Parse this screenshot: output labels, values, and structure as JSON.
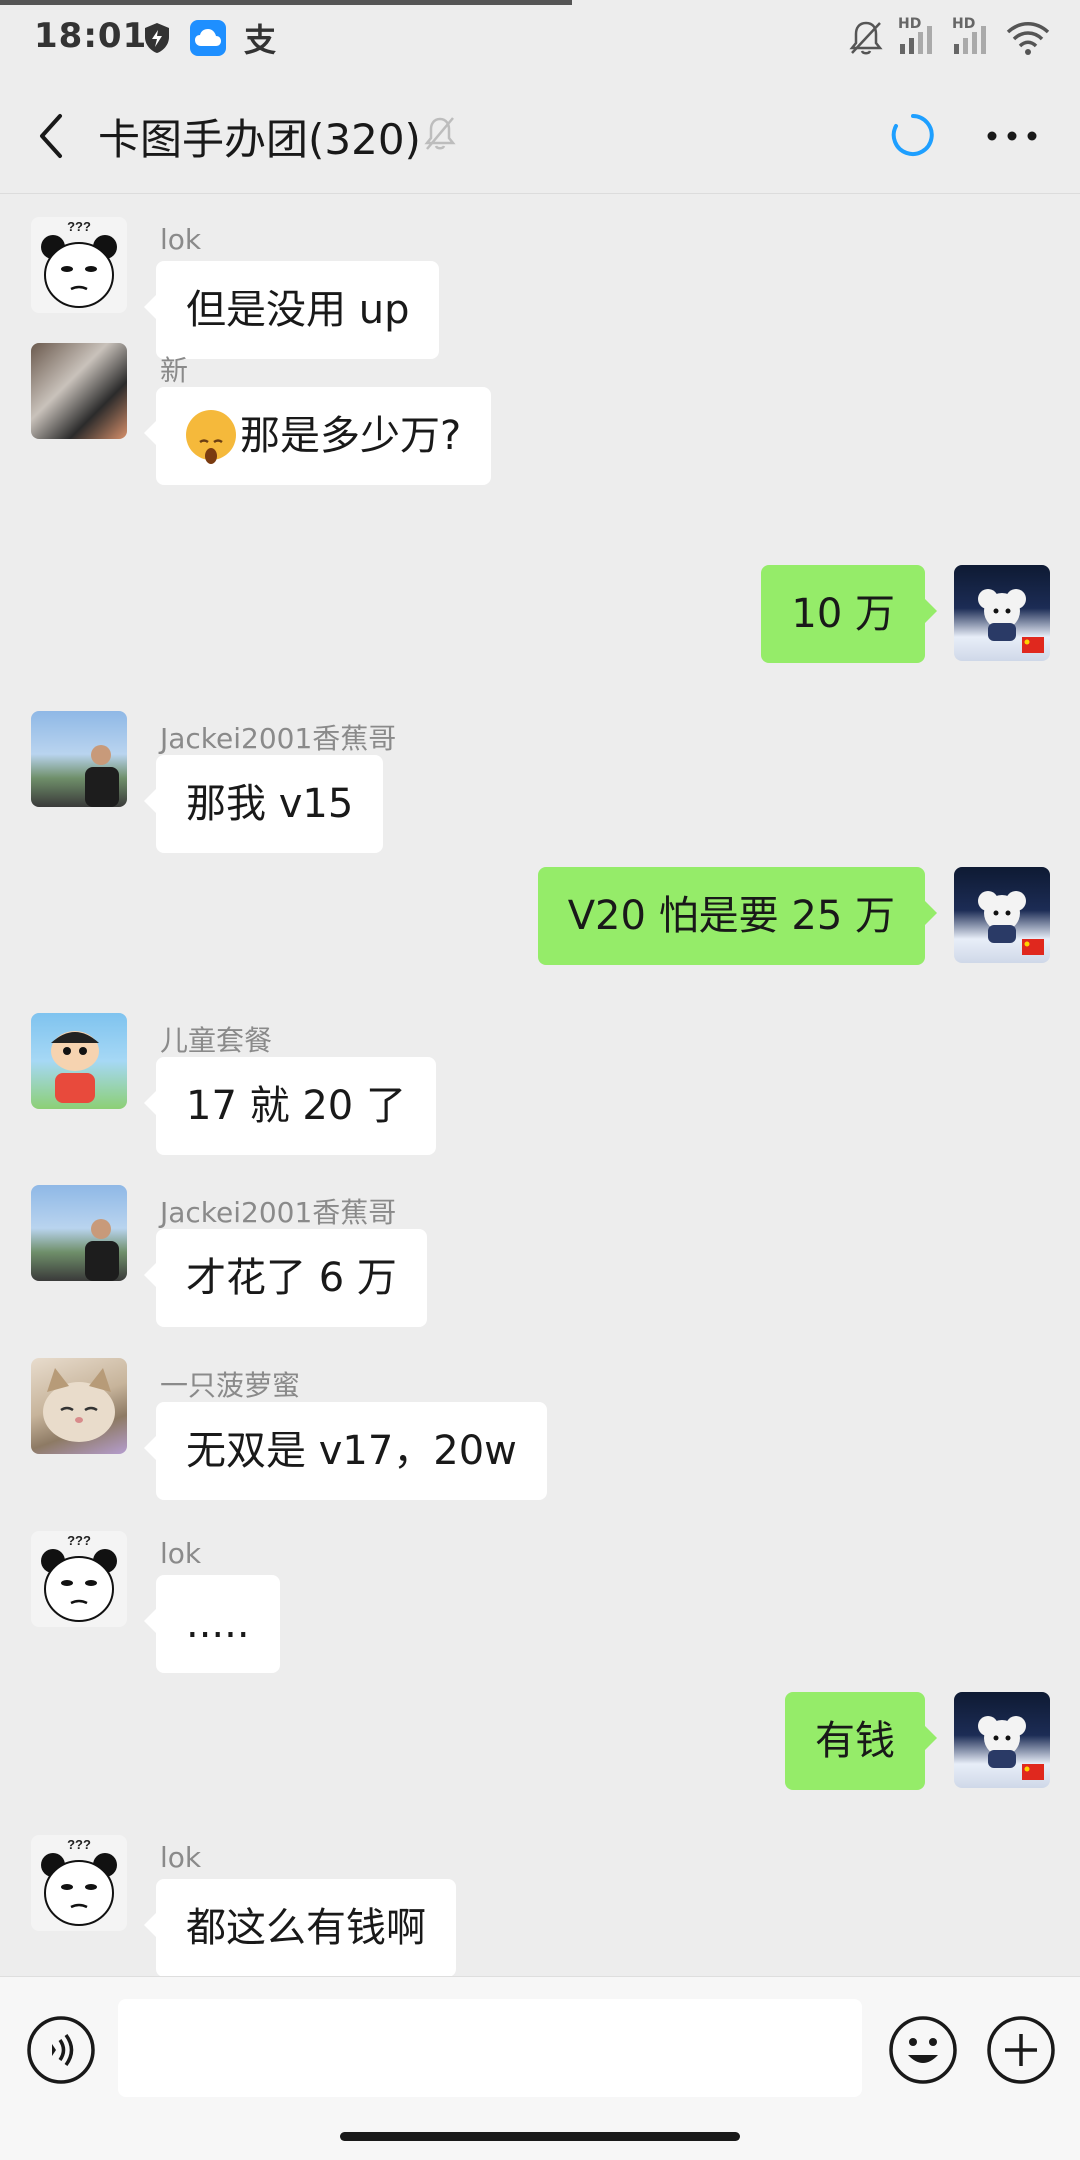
{
  "status_bar": {
    "time": "18:01",
    "icons": [
      "shield-icon",
      "cloud-icon",
      "alipay-icon",
      "mute-bell-icon",
      "hd-signal-icon",
      "hd-signal-icon",
      "wifi-icon"
    ],
    "alipay_glyph": "支",
    "hd_label": "HD"
  },
  "header": {
    "title": "卡图手办团(320)",
    "icons": [
      "back-icon",
      "mute-icon",
      "sync-icon",
      "more-icon"
    ]
  },
  "messages": [
    {
      "side": "left",
      "sender": "lok",
      "text": "但是没用 up",
      "avatar": "panda"
    },
    {
      "side": "left",
      "sender": "新",
      "text": "那是多少万?",
      "emoji": "yawn-face",
      "avatar": "photo"
    },
    {
      "side": "right",
      "text": "10 万",
      "avatar": "dog"
    },
    {
      "side": "left",
      "sender": "Jackei2001香蕉哥",
      "text": "那我 v15",
      "avatar": "man"
    },
    {
      "side": "right",
      "text": "V20 怕是要 25 万",
      "avatar": "dog"
    },
    {
      "side": "left",
      "sender": "儿童套餐",
      "text": "17 就 20 了",
      "avatar": "kid"
    },
    {
      "side": "left",
      "sender": "Jackei2001香蕉哥",
      "text": "才花了 6 万",
      "avatar": "man"
    },
    {
      "side": "left",
      "sender": "一只菠萝蜜",
      "text": "无双是 v17，20w",
      "avatar": "cat"
    },
    {
      "side": "left",
      "sender": "lok",
      "text": ".....",
      "avatar": "panda"
    },
    {
      "side": "right",
      "text": "有钱",
      "avatar": "dog"
    },
    {
      "side": "left",
      "sender": "lok",
      "text": "都这么有钱啊",
      "avatar": "panda"
    }
  ],
  "panda_caption": "???",
  "input_bar": {
    "value": "",
    "icons": [
      "voice-icon",
      "emoji-icon",
      "plus-icon"
    ]
  },
  "colors": {
    "background": "#ededed",
    "bubble_in": "#ffffff",
    "bubble_out": "#95ec69",
    "sync_accent": "#1e9fff"
  }
}
